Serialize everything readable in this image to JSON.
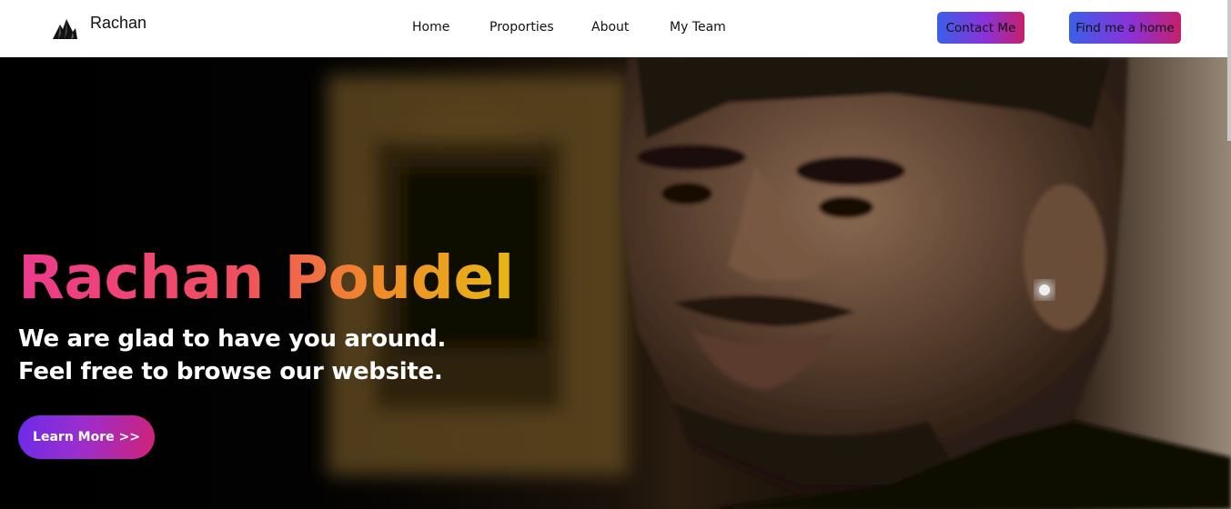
{
  "brand": {
    "name": "Rachan",
    "logo_icon": "mountain-peaks-icon"
  },
  "nav": {
    "links": [
      "Home",
      "Proporties",
      "About",
      "My Team"
    ],
    "contact_label": "Contact Me",
    "find_home_label": "Find me a home"
  },
  "hero": {
    "headline": "Rachan Poudel",
    "tagline_line1": "We are glad to have you around.",
    "tagline_line2": "Feel free to browse our website.",
    "cta_label": "Learn More >>",
    "photo": "portrait-photo"
  },
  "colors": {
    "button_gradient": [
      "#3a60e8",
      "#8a32d8",
      "#c5206a"
    ],
    "headline_gradient": [
      "#ec3a8e",
      "#f0505e",
      "#f08a2a",
      "#e6b814"
    ],
    "cta_gradient": [
      "#6c2be8",
      "#9a2ecf",
      "#d02277"
    ]
  }
}
